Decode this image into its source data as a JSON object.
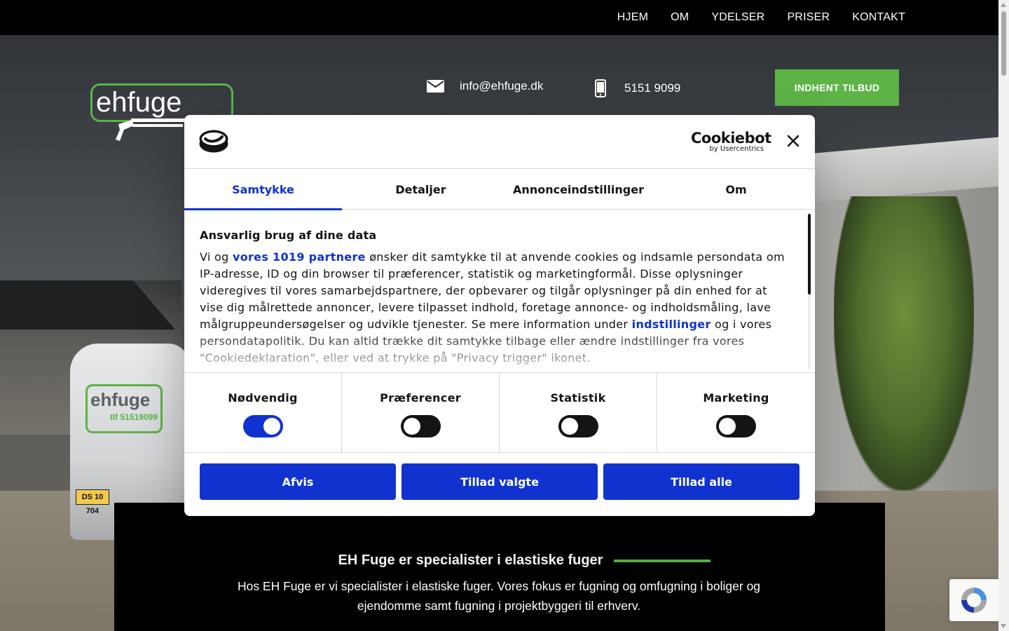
{
  "nav": {
    "items": [
      "HJEM",
      "OM",
      "YDELSER",
      "PRISER",
      "KONTAKT"
    ]
  },
  "header": {
    "logo_text": "ehfuge",
    "email": "info@ehfuge.dk",
    "phone": "5151 9099",
    "cta_label": "INDHENT TILBUD"
  },
  "van": {
    "logo_text": "ehfuge",
    "phone_text": "tlf 51519099",
    "plate": "DS 10 704"
  },
  "info": {
    "title": "EH Fuge er specialister i elastiske fuger",
    "text": "Hos EH Fuge er vi specialister i elastiske fuger. Vores fokus er fugning og omfugning i boliger og ejendomme samt fugning i projektbyggeri til erhverv."
  },
  "cookie": {
    "brand": "Cookiebot",
    "brand_sub": "by Usercentrics",
    "tabs": [
      "Samtykke",
      "Detaljer",
      "Annonceindstillinger",
      "Om"
    ],
    "heading": "Ansvarlig brug af dine data",
    "body_1": "Vi og ",
    "link_partners": "vores 1019 partnere",
    "body_2": " ønsker dit samtykke til at anvende cookies og indsamle persondata om IP-adresse, ID og din browser til præferencer, statistik og marketingformål. Disse oplysninger videregives til vores samarbejdspartnere, der opbevarer og tilgår oplysninger på din enhed for at vise dig målrettede annoncer, levere tilpasset indhold, foretage annonce- og indholdsmåling, lave målgruppeundersøgelser og udvikle tjenester. Se mere information under ",
    "link_settings": "indstillinger",
    "body_3": " og i vores persondatapolitik. Du kan altid trække dit samtykke tilbage eller ændre indstillinger fra vores \"Cookiedeklaration\", eller ved at trykke på \"Privacy trigger\" ikonet.",
    "toggles": [
      {
        "label": "Nødvendig",
        "on": true
      },
      {
        "label": "Præferencer",
        "on": false
      },
      {
        "label": "Statistik",
        "on": false
      },
      {
        "label": "Marketing",
        "on": false
      }
    ],
    "buttons": [
      "Afvis",
      "Tillad valgte",
      "Tillad alle"
    ]
  },
  "colors": {
    "brand_green": "#5db346",
    "cookie_blue": "#1032cf"
  }
}
